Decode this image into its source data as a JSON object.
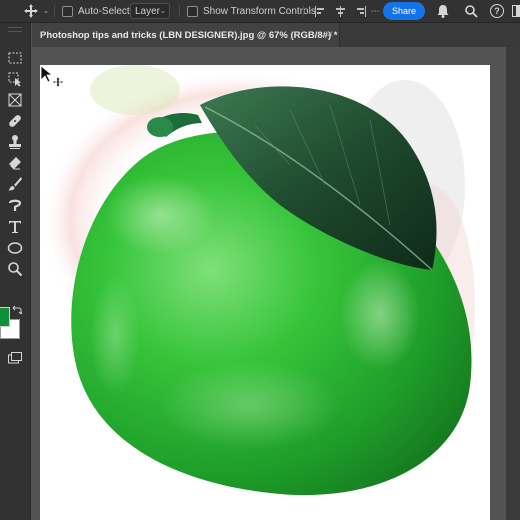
{
  "options_bar": {
    "auto_select_label": "Auto-Select:",
    "layer_select_value": "Layer",
    "show_transform_label": "Show Transform Controls",
    "share_label": "Share"
  },
  "document": {
    "tab_title": "Photoshop tips and tricks (LBN DESIGNER).jpg @ 67% (RGB/8#) *",
    "close_glyph": "×"
  },
  "tools": [
    "marquee",
    "object-select",
    "crop",
    "healing",
    "clone-stamp",
    "eraser",
    "brush",
    "smudge",
    "type",
    "ellipse",
    "zoom"
  ],
  "colors": {
    "foreground": "#0f8f3b",
    "background": "#ffffff",
    "accent": "#1473e6",
    "mango_green": "#2fbf3a",
    "leaf_dark": "#1e4a2c"
  }
}
